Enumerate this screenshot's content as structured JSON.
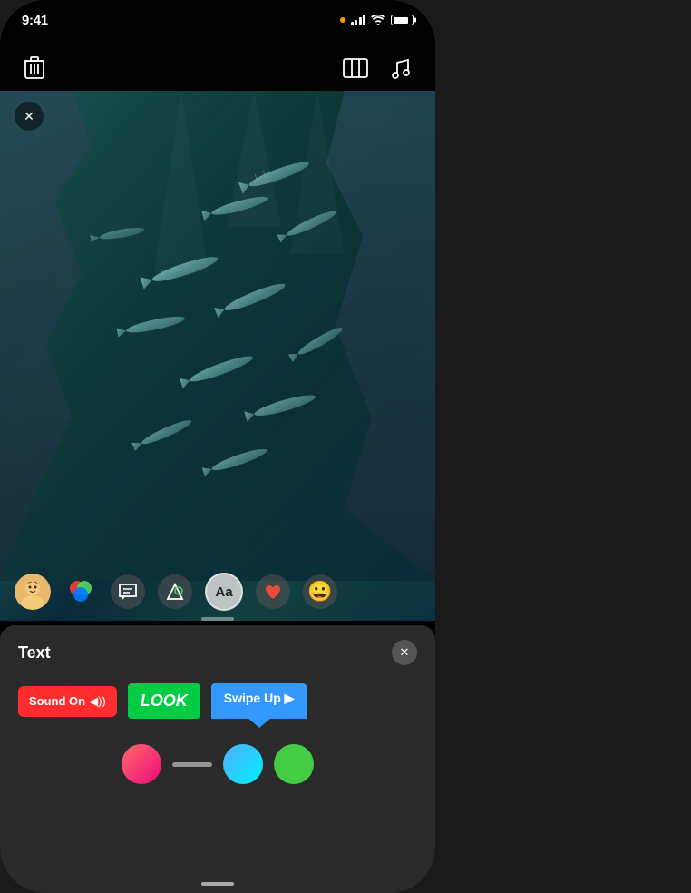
{
  "status_bar": {
    "time": "9:41",
    "battery_level": "80"
  },
  "top_toolbar": {
    "delete_icon": "🗑",
    "slideshow_icon": "⊟",
    "music_icon": "♪"
  },
  "video": {
    "close_button_label": "✕"
  },
  "video_toolbar": {
    "memoji_icon": "😊",
    "colors_icon": "◉",
    "message_icon": "💬",
    "shapes_icon": "△",
    "text_icon": "Aa",
    "sticker_icon": "❤",
    "emoji_icon": "😀"
  },
  "bottom_panel": {
    "title": "Text",
    "close_button_label": "✕",
    "stickers": [
      {
        "id": "sound-on",
        "label": "Sound On",
        "suffix": "◉))",
        "style": "red"
      },
      {
        "id": "look",
        "label": "LOOK",
        "style": "green"
      },
      {
        "id": "swipe-up",
        "label": "Swipe Up",
        "suffix": "→",
        "style": "blue"
      }
    ],
    "color_swatches": [
      "pink-gradient",
      "blue-gradient",
      "green"
    ]
  }
}
